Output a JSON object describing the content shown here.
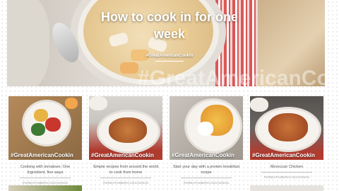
{
  "hero": {
    "title": "How to cook in for one week",
    "hashtag": "#GreatAmericanCookin",
    "watermark": "#GreatAmericanCookin"
  },
  "cards": [
    {
      "title": "Cooking with tomatoes: One Ingredient, five ways",
      "hashtag": "#GreatAmericanCookin",
      "source": "#GREATAMERICANCOOKIN"
    },
    {
      "title": "Simple recipes from around the world to cook from home",
      "hashtag": "#GreatAmericanCookin",
      "source": "#GREATAMERICANCOOKIN"
    },
    {
      "title": "Start your day with a protein breakfast recipe",
      "hashtag": "#GreatAmericanCookin",
      "source": "#GREATAMERICANCOOKIN"
    },
    {
      "title": "Moroccan Chicken",
      "hashtag": "#GreatAmericanCookin",
      "source": "#GREATAMERICANCOOKIN"
    }
  ]
}
